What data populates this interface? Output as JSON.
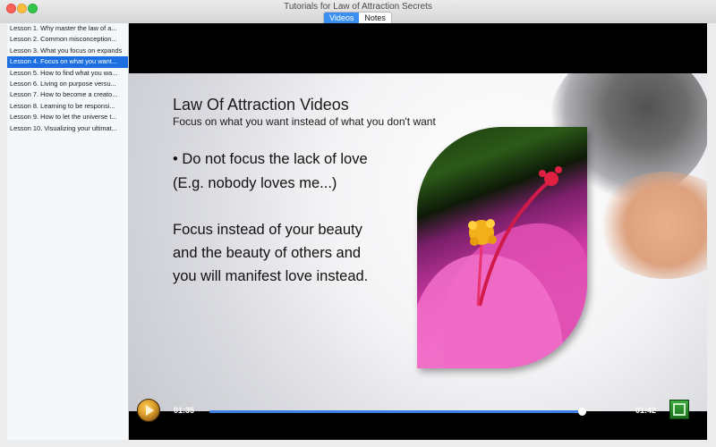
{
  "window": {
    "title": "Tutorials for Law of Attraction Secrets"
  },
  "tabs": [
    {
      "label": "Videos",
      "active": true
    },
    {
      "label": "Notes",
      "active": false
    }
  ],
  "sidebar": {
    "lessons": [
      "Lesson 1. Why master the law of a...",
      "Lesson 2. Common misconception...",
      "Lesson 3. What you focus on expands",
      "Lesson 4. Focus on what you want...",
      "Lesson 5. How to find what you wa...",
      "Lesson 6. Living on purpose versu...",
      "Lesson 7. How to become a creato...",
      "Lesson 8. Learning to be responsi...",
      "Lesson 9. How to let the universe t...",
      "Lesson 10. Visualizing your ultimat..."
    ],
    "selected_index": 3
  },
  "slide": {
    "title": "Law Of Attraction Videos",
    "subtitle": "Focus on what you want instead of what you don't want",
    "bullet_line1": "• Do not focus the lack of love",
    "bullet_line2": "(E.g. nobody loves me...)",
    "body_line1": "Focus instead of your beauty",
    "body_line2": "and the beauty of others and",
    "body_line3": "you will manifest love instead."
  },
  "player": {
    "current_time": "01:35",
    "total_time": "01:42",
    "progress": 0.99,
    "accent_color": "#3d7fe6"
  },
  "icons": {
    "play": "play-icon",
    "fullscreen": "fullscreen-icon"
  }
}
